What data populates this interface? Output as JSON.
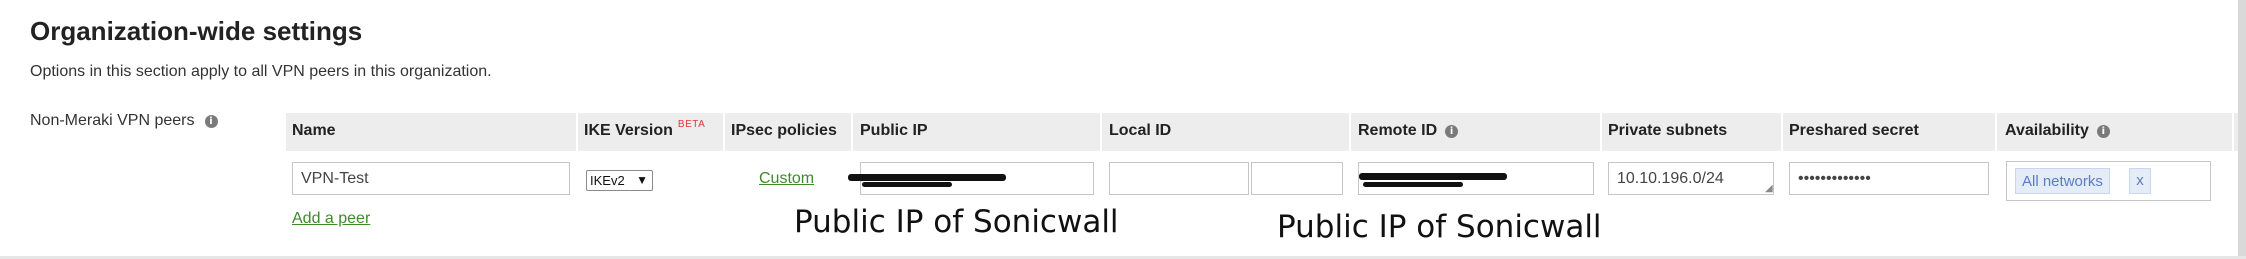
{
  "section": {
    "title": "Organization-wide settings",
    "description": "Options in this section apply to all VPN peers in this organization."
  },
  "peers_label": "Non-Meraki VPN peers",
  "info_icon_char": "i",
  "columns": {
    "name": "Name",
    "ike_version": "IKE Version",
    "ike_beta": "BETA",
    "ipsec_policies": "IPsec policies",
    "public_ip": "Public IP",
    "local_id": "Local ID",
    "remote_id": "Remote ID",
    "private_subnets": "Private subnets",
    "preshared_secret": "Preshared secret",
    "availability": "Availability"
  },
  "peer_row": {
    "name": "VPN-Test",
    "ike_version": "IKEv2",
    "ipsec_policies": "Custom",
    "public_ip": "",
    "local_id": "",
    "remote_id": "",
    "private_subnets": "10.10.196.0/24",
    "preshared_secret": "•••••••••••••",
    "availability_chip": "All networks",
    "availability_remove": "x"
  },
  "add_peer_label": "Add a peer",
  "annotations": {
    "public_ip_note": "Public IP of Sonicwall",
    "remote_id_note": "Public IP of Sonicwall"
  },
  "colors": {
    "link": "#3e8a2d",
    "beta": "#e03a3a",
    "header_bg": "#ededed",
    "chip_text": "#5a7cc0",
    "chip_bg": "#e4ecf8"
  },
  "icons": {
    "info": "info-icon",
    "select_chevron": "chevron-down-icon"
  }
}
